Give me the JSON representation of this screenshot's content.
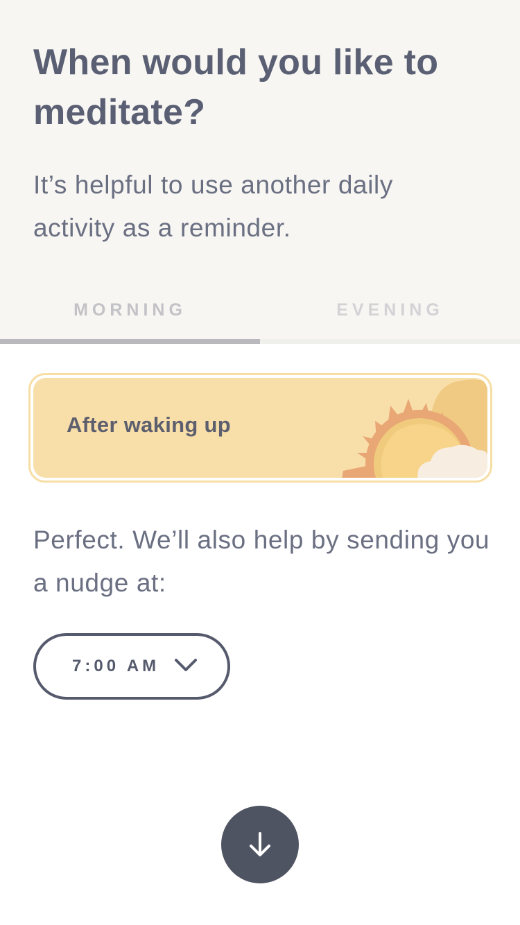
{
  "header": {
    "title": "When would you like to meditate?",
    "subtitle": "It’s helpful to use another daily activity as a reminder."
  },
  "tabs": [
    {
      "label": "MORNING",
      "selected": true
    },
    {
      "label": "EVENING",
      "selected": false
    }
  ],
  "option": {
    "label": "After waking up",
    "icon": "sun-icon"
  },
  "nudge": {
    "text": "Perfect. We’ll also help by sending you a nudge at:",
    "time": "7:00 AM",
    "dropdown_icon": "chevron-down-icon"
  },
  "next_button": {
    "icon": "arrow-down-icon"
  },
  "colors": {
    "panel_bg": "#f7f6f2",
    "card_fill": "#f8dfaa",
    "card_border": "#f7dea4",
    "sun_rays": "#e8a775",
    "text": "#5a5f73",
    "button_bg": "#4f5462"
  }
}
